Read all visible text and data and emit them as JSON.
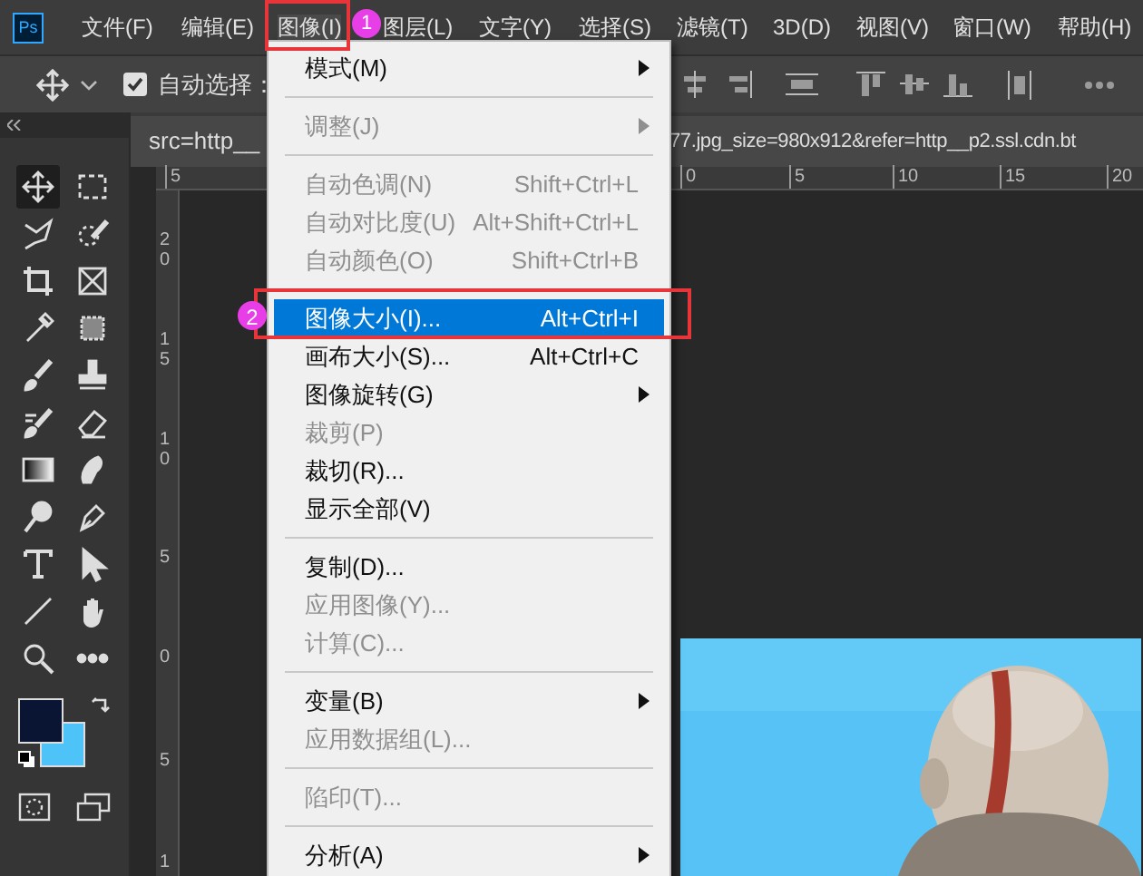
{
  "app_logo": "Ps",
  "menubar": [
    {
      "label": "文件(F)",
      "selected": false
    },
    {
      "label": "编辑(E)",
      "selected": false
    },
    {
      "label": "图像(I)",
      "selected": true
    },
    {
      "label": "图层(L)",
      "selected": false
    },
    {
      "label": "文字(Y)",
      "selected": false
    },
    {
      "label": "选择(S)",
      "selected": false
    },
    {
      "label": "滤镜(T)",
      "selected": false
    },
    {
      "label": "3D(D)",
      "selected": false
    },
    {
      "label": "视图(V)",
      "selected": false
    },
    {
      "label": "窗口(W)",
      "selected": false
    },
    {
      "label": "帮助(H)",
      "selected": false
    }
  ],
  "options_bar": {
    "auto_select": {
      "label": "自动选择：",
      "checked": true
    }
  },
  "document_tab": {
    "title_left": "src=http__",
    "title_right": "77.jpg_size=980x912&refer=http__p2.ssl.cdn.bt"
  },
  "rulers": {
    "horizontal": [
      "5",
      "0",
      "5",
      "10",
      "15",
      "20"
    ],
    "vertical": [
      "20",
      "15",
      "10",
      "5",
      "0",
      "5",
      "1"
    ]
  },
  "menu": [
    {
      "kind": "item",
      "label": "模式(M)",
      "submenu": true,
      "disabled": false,
      "selected": false
    },
    {
      "kind": "separator"
    },
    {
      "kind": "item",
      "label": "调整(J)",
      "submenu": true,
      "disabled": true,
      "selected": false
    },
    {
      "kind": "separator"
    },
    {
      "kind": "item",
      "label": "自动色调(N)",
      "shortcut": "Shift+Ctrl+L",
      "disabled": true,
      "selected": false
    },
    {
      "kind": "item",
      "label": "自动对比度(U)",
      "shortcut": "Alt+Shift+Ctrl+L",
      "disabled": true,
      "selected": false
    },
    {
      "kind": "item",
      "label": "自动颜色(O)",
      "shortcut": "Shift+Ctrl+B",
      "disabled": true,
      "selected": false
    },
    {
      "kind": "separator"
    },
    {
      "kind": "item",
      "label": "图像大小(I)...",
      "shortcut": "Alt+Ctrl+I",
      "disabled": false,
      "selected": true
    },
    {
      "kind": "item",
      "label": "画布大小(S)...",
      "shortcut": "Alt+Ctrl+C",
      "disabled": false,
      "selected": false
    },
    {
      "kind": "item",
      "label": "图像旋转(G)",
      "submenu": true,
      "disabled": false,
      "selected": false
    },
    {
      "kind": "item",
      "label": "裁剪(P)",
      "disabled": true,
      "selected": false
    },
    {
      "kind": "item",
      "label": "裁切(R)...",
      "disabled": false,
      "selected": false
    },
    {
      "kind": "item",
      "label": "显示全部(V)",
      "disabled": false,
      "selected": false
    },
    {
      "kind": "separator"
    },
    {
      "kind": "item",
      "label": "复制(D)...",
      "disabled": false,
      "selected": false
    },
    {
      "kind": "item",
      "label": "应用图像(Y)...",
      "disabled": true,
      "selected": false
    },
    {
      "kind": "item",
      "label": "计算(C)...",
      "disabled": true,
      "selected": false
    },
    {
      "kind": "separator"
    },
    {
      "kind": "item",
      "label": "变量(B)",
      "submenu": true,
      "disabled": false,
      "selected": false
    },
    {
      "kind": "item",
      "label": "应用数据组(L)...",
      "disabled": true,
      "selected": false
    },
    {
      "kind": "separator"
    },
    {
      "kind": "item",
      "label": "陷印(T)...",
      "disabled": true,
      "selected": false
    },
    {
      "kind": "separator"
    },
    {
      "kind": "item",
      "label": "分析(A)",
      "submenu": true,
      "disabled": false,
      "selected": false
    }
  ],
  "annotations": [
    {
      "label": "1"
    },
    {
      "label": "2"
    }
  ]
}
